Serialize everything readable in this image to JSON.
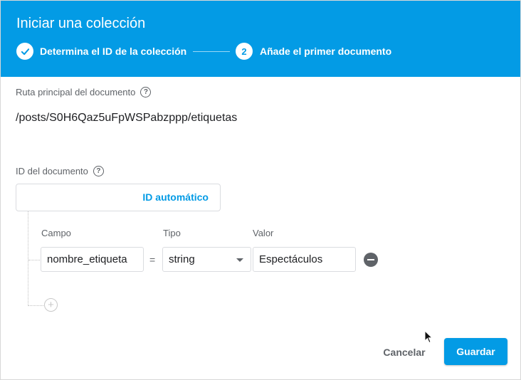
{
  "dialog": {
    "title": "Iniciar una colección"
  },
  "steps": [
    {
      "label": "Determina el ID de la colección",
      "icon": "check-icon",
      "state": "done"
    },
    {
      "number": "2",
      "label": "Añade el primer documento",
      "state": "active"
    }
  ],
  "parent_path": {
    "label": "Ruta principal del documento",
    "help": "?",
    "value": "/posts/S0H6Qaz5uFpWSPabzppp/etiquetas"
  },
  "document_id": {
    "label": "ID del documento",
    "help": "?",
    "value": "",
    "auto_id_label": "ID automático"
  },
  "fields": {
    "headers": {
      "field": "Campo",
      "type": "Tipo",
      "value": "Valor"
    },
    "rows": [
      {
        "name": "nombre_etiqueta",
        "equals": "=",
        "type": "string",
        "value": "Espectáculos"
      }
    ],
    "add_symbol": "+"
  },
  "actions": {
    "cancel_label": "Cancelar",
    "save_label": "Guardar"
  },
  "colors": {
    "primary": "#039be5",
    "text": "#202124",
    "muted": "#5f6368"
  }
}
